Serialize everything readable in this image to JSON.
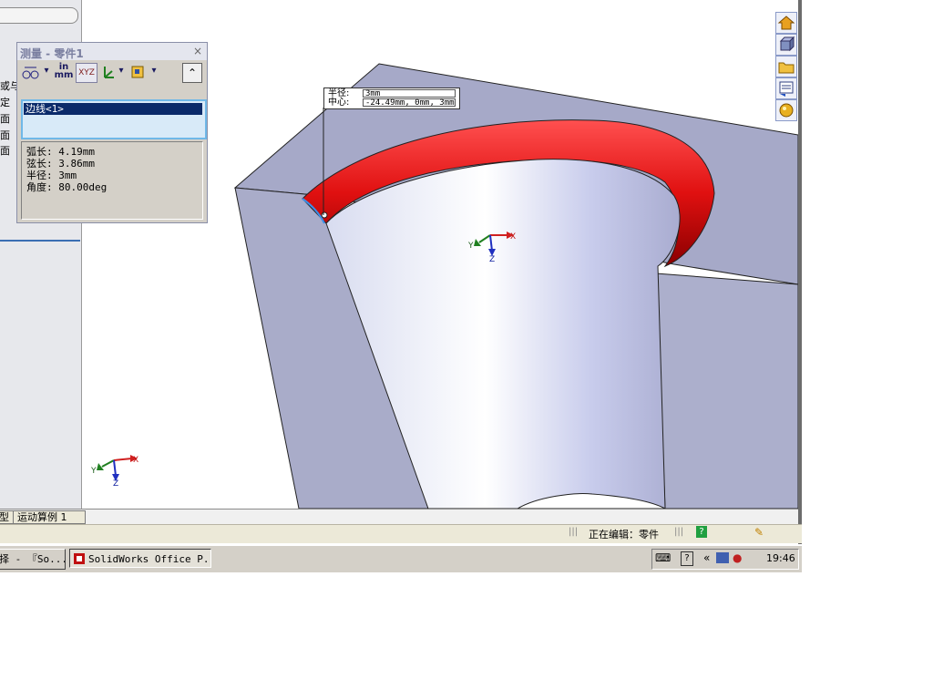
{
  "left_panel": {
    "fragments": [
      "或与水",
      "定",
      "面",
      "面",
      "面"
    ]
  },
  "measure_dialog": {
    "title": "测量 - 零件1",
    "close": "×",
    "toolbar": {
      "units_in": "in",
      "units_mm": "mm",
      "xyz": "XYZ",
      "dropdown": "▾",
      "collapse": "⌃"
    },
    "selection": "边线<1>",
    "results": [
      "弧长: 4.19mm",
      "弦长: 3.86mm",
      "半径: 3mm",
      "角度: 80.00deg"
    ]
  },
  "callout": {
    "radius_label": "半径:",
    "radius_value": "3mm",
    "center_label": "中心:",
    "center_value": "-24.49mm, 0mm, 3mm"
  },
  "triad": {
    "x": "X",
    "y": "Y",
    "z": "Z"
  },
  "tabs": [
    "型",
    "运动算例 1"
  ],
  "status": {
    "editing": "正在编辑：零件",
    "help": "?"
  },
  "taskbar": {
    "items": [
      "择 - 『So...",
      "SolidWorks Office P..."
    ],
    "clock": "19:46",
    "tray_chevron": "«"
  },
  "colors": {
    "fillet": "#e01010",
    "body": "#a9accb",
    "viewport_bg": "#ffffff",
    "selection_bg": "#0a2a6a"
  },
  "icons": {
    "measure_tools": [
      "arc-center-icon",
      "units-icon",
      "xyz-icon",
      "coordinate-system-icon",
      "projection-icon",
      "collapse-icon"
    ],
    "heads_up": [
      "home-icon",
      "view-orientation-icon",
      "open-folder-icon",
      "properties-icon",
      "appearance-icon"
    ]
  }
}
